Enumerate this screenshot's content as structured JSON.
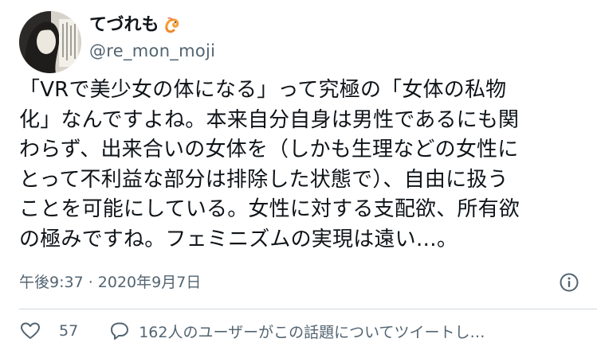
{
  "author": {
    "display_name": "てづれも",
    "handle": "@re_mon_moji"
  },
  "tweet": {
    "text": "「VRで美少女の体になる」って究極の「女体の私物\n化」なんですよね。本来自分自身は男性であるにも関\nわらず、出来合いの女体を（しかも生理などの女性に\nとって不利益な部分は排除した状態で）、自由に扱う\nことを可能にしている。女性に対する支配欲、所有欲\nの極みですね。フェミニズムの実現は遠い…。",
    "timestamp": "午後9:37 · 2020年9月7日"
  },
  "actions": {
    "like_count": "57",
    "conversation": "162人のユーザーがこの話題についてツイートし…"
  },
  "icons": {
    "name_emoji": "shrimp-icon",
    "info": "info-icon",
    "like": "heart-icon",
    "reply": "reply-icon"
  },
  "colors": {
    "text": "#0f1419",
    "secondary": "#536471",
    "divider": "#cfd9de"
  }
}
